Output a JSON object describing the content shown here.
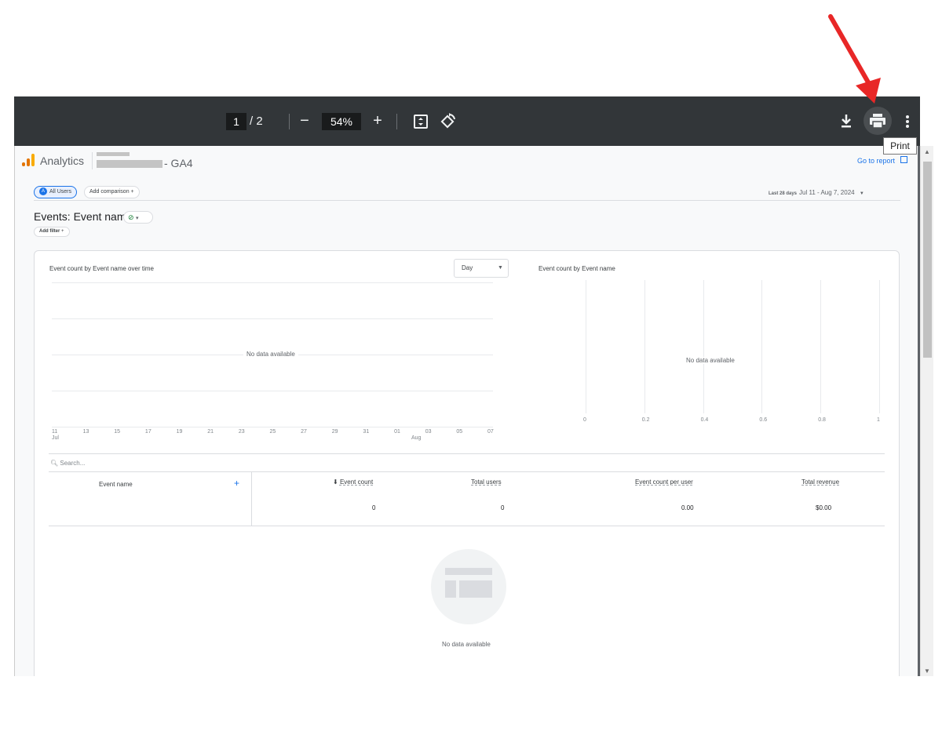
{
  "viewer": {
    "page_current": "1",
    "page_total": "/ 2",
    "zoom": "54%",
    "zoom_out": "−",
    "zoom_in": "+",
    "tooltip": "Print",
    "icons": [
      "fit-page-icon",
      "rotate-icon",
      "download-icon",
      "print-icon",
      "more-vert-icon"
    ]
  },
  "report": {
    "app_name": "Analytics",
    "property_suffix": "- GA4",
    "go_to_report": "Go to report",
    "all_users": "All Users",
    "all_users_badge": "A",
    "add_comparison": "Add comparison",
    "plus": "+",
    "date_prefix": "Last 28 days",
    "date_range": "Jul 11 - Aug 7, 2024",
    "heading": "Events: Event name",
    "add_filter": "Add filter"
  },
  "line_chart": {
    "title": "Event count by Event name over time",
    "granularity": "Day",
    "no_data": "No data available",
    "x_ticks": [
      "11",
      "13",
      "15",
      "17",
      "19",
      "21",
      "23",
      "25",
      "27",
      "29",
      "31",
      "01",
      "03",
      "05",
      "07"
    ],
    "month_labels": {
      "jul": "Jul",
      "aug": "Aug"
    }
  },
  "bar_chart": {
    "title": "Event count by Event name",
    "no_data": "No data available",
    "x_ticks": [
      "0",
      "0.2",
      "0.4",
      "0.6",
      "0.8",
      "1"
    ]
  },
  "table": {
    "search_placeholder": "Search...",
    "col_event_name": "Event name",
    "col_event_count": "Event count",
    "col_total_users": "Total users",
    "col_per_user": "Event count per user",
    "col_revenue": "Total revenue",
    "sort_arrow": "⬇",
    "totals": {
      "event_count": "0",
      "total_users": "0",
      "per_user": "0.00",
      "revenue": "$0.00"
    },
    "empty_text": "No data available"
  },
  "colors": {
    "toolbar": "#323639",
    "accent": "#1a73e8",
    "annotation_arrow": "#e82727"
  }
}
